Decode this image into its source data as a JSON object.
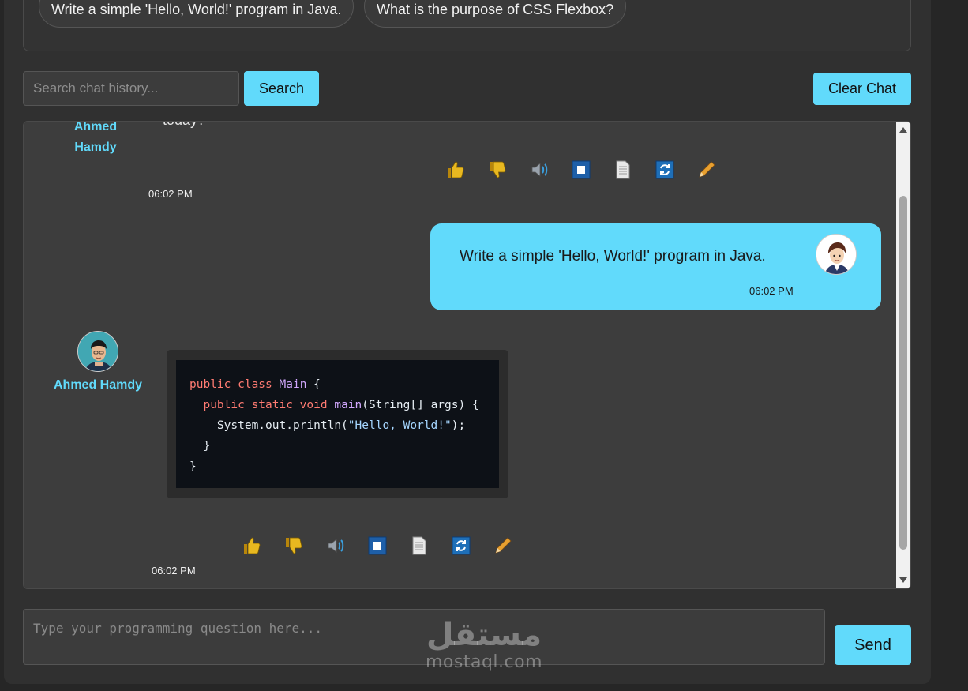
{
  "suggestions": [
    "Write a simple 'Hello, World!' program in Java.",
    "What is the purpose of CSS Flexbox?"
  ],
  "search": {
    "placeholder": "Search chat history...",
    "button": "Search"
  },
  "clear_button": "Clear Chat",
  "messages": {
    "bot1": {
      "username_line1": "Ahmed",
      "username_line2": "Hamdy",
      "partial_text": "today?",
      "time": "06:02 PM"
    },
    "user1": {
      "text": "Write a simple 'Hello, World!' program in Java.",
      "time": "06:02 PM"
    },
    "bot2": {
      "username": "Ahmed Hamdy",
      "code_lines": [
        "public class Main {",
        "  public static void main(String[] args) {",
        "    System.out.println(\"Hello, World!\");",
        "  }",
        "}"
      ],
      "time": "06:02 PM"
    }
  },
  "composer": {
    "placeholder": "Type your programming question here...",
    "send": "Send"
  },
  "watermark": {
    "arabic": "مستقل",
    "latin": "mostaql.com"
  },
  "colors": {
    "accent": "#61dafb",
    "background": "#262626",
    "panel": "#303030",
    "chat_bg": "#3d3d3d",
    "code_bg": "#0d1117"
  },
  "icons": [
    "thumbs-up-icon",
    "thumbs-down-icon",
    "speaker-icon",
    "stop-icon",
    "document-icon",
    "refresh-icon",
    "pencil-icon"
  ]
}
